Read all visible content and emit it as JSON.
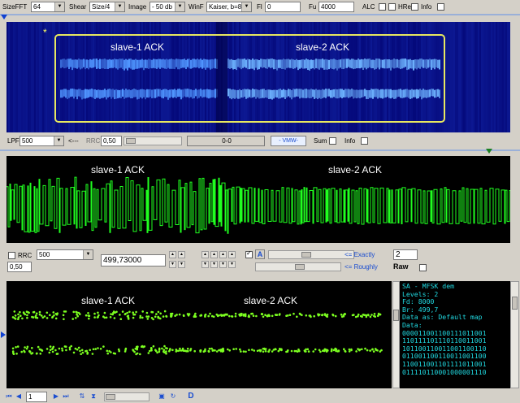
{
  "toolbar": {
    "sizefft_label": "SizeFFT",
    "sizefft_value": "64",
    "shear_label": "Shear",
    "shear_value": "Size/4",
    "image_label": "Image",
    "image_value": "- 50 db",
    "winf_label": "WinF",
    "winf_value": "Kaiser, b=8",
    "fl_label": "Fl",
    "fl_value": "0",
    "fu_label": "Fu",
    "fu_value": "4000",
    "alc_label": "ALC",
    "hres_label": "HRes",
    "info_label": "Info"
  },
  "spectrogram": {
    "marker": "*",
    "label_1": "slave-1 ACK",
    "label_2": "slave-2 ACK"
  },
  "filterbar": {
    "lpf_label": "LPF",
    "lpf_value": "500",
    "arrow_label": "<---",
    "rrc_label": "RRC",
    "rrc_value": "0,50",
    "range_value": "0-0",
    "vmw_label": "- VMW-",
    "sum_label": "Sum",
    "info_label": "Info"
  },
  "waveform": {
    "label_1": "slave-1 ACK",
    "label_2": "slave-2 ACK"
  },
  "controls": {
    "rrc_label": "RRC",
    "rrc_filter_value": "500",
    "rrc_beta_value": "0,50",
    "rate_value": "499,73000",
    "a_label": "A",
    "exactly_label": "<= Exactly",
    "roughly_label": "<= Roughly",
    "spin_value": "2",
    "raw_label": "Raw"
  },
  "scatter": {
    "label_1": "slave-1 ACK",
    "label_2": "slave-2 ACK"
  },
  "decoder_lines": [
    "SA - MFSK dem",
    "Levels: 2",
    "Fd: 8000",
    "Br: 499,7",
    "Data as: Default map",
    "Data:",
    "000011001100111011001",
    "110111101110110011001",
    "101100110011001100110",
    "011001100110011001100",
    "110011001101111011001",
    "011110110001000001110"
  ],
  "bottombar": {
    "page_value": "1",
    "d_label": "D"
  },
  "colors": {
    "spec_bg": "#00008a",
    "box": "#e8e860",
    "wave": "#20ff20",
    "decoder_text": "#20d8e0"
  }
}
